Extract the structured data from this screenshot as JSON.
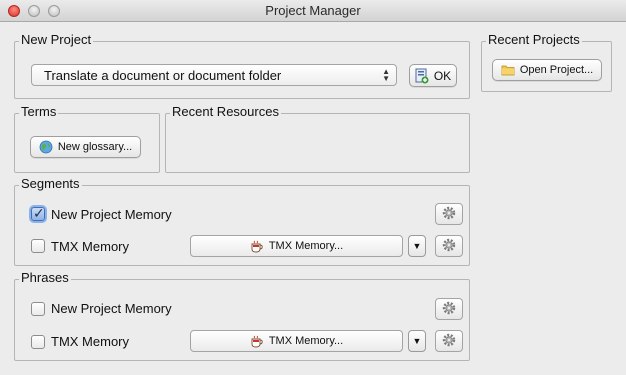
{
  "window": {
    "title": "Project Manager"
  },
  "new_project": {
    "title": "New Project",
    "selected_option": "Translate a document or document folder",
    "ok_label": "OK"
  },
  "recent_projects": {
    "title": "Recent Projects",
    "open_label": "Open Project..."
  },
  "terms": {
    "title": "Terms",
    "new_glossary_label": "New glossary..."
  },
  "recent_resources": {
    "title": "Recent Resources"
  },
  "segments": {
    "title": "Segments",
    "new_memory": {
      "label": "New Project Memory",
      "checked": true
    },
    "tmx_memory": {
      "label": "TMX Memory",
      "checked": false,
      "button_label": "TMX Memory..."
    }
  },
  "phrases": {
    "title": "Phrases",
    "new_memory": {
      "label": "New Project Memory",
      "checked": false
    },
    "tmx_memory": {
      "label": "TMX Memory",
      "checked": false,
      "button_label": "TMX Memory..."
    }
  }
}
